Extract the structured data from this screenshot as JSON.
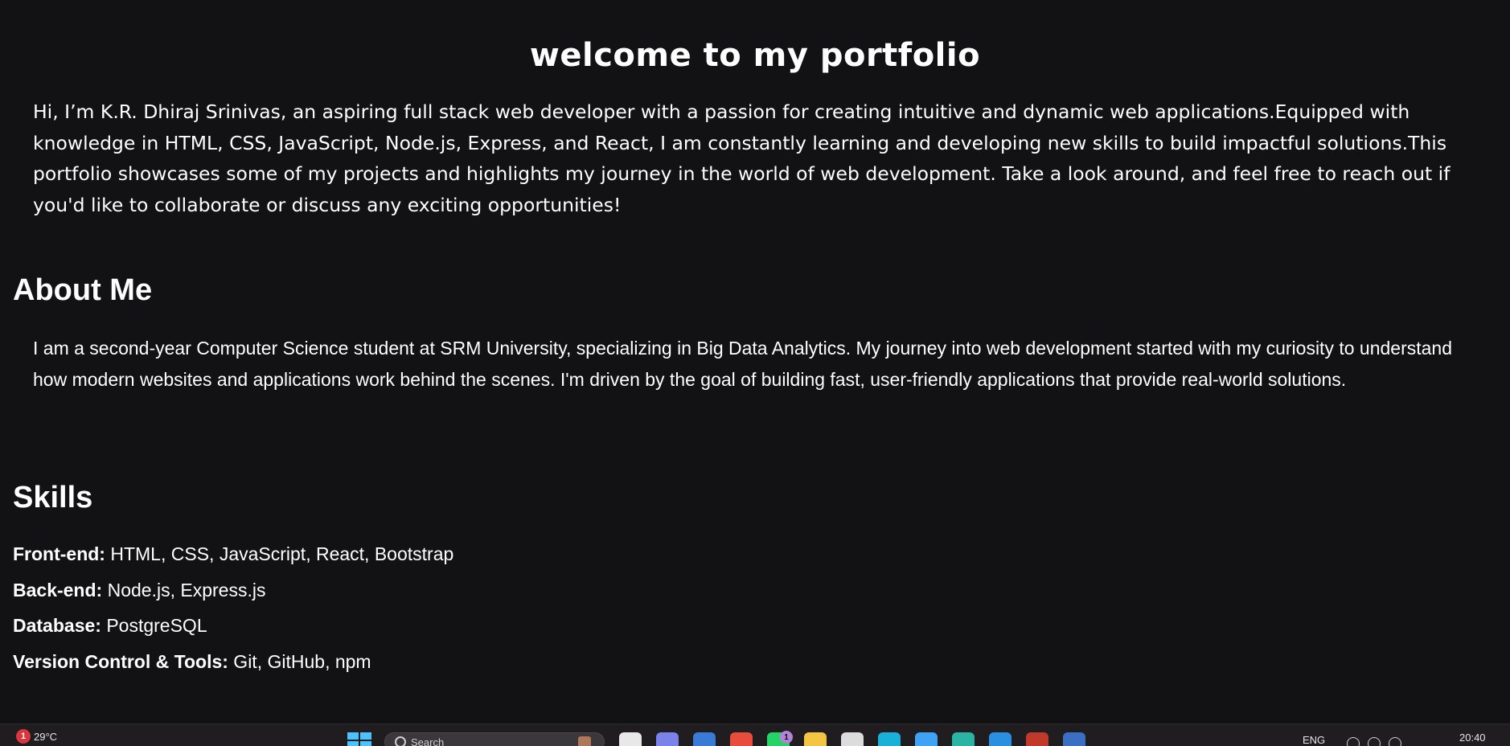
{
  "hero": {
    "title": "welcome to my portfolio",
    "intro": "Hi, I’m K.R. Dhiraj Srinivas, an aspiring full stack web developer with a passion for creating intuitive and dynamic web applications.Equipped with knowledge in HTML, CSS, JavaScript, Node.js, Express, and React, I am constantly learning and developing new skills to build impactful solutions.This portfolio showcases some of my projects and highlights my journey in the world of web development. Take a look around, and feel free to reach out if you'd like to collaborate or discuss any exciting opportunities!"
  },
  "about": {
    "heading": "About Me",
    "text": "I am a second-year Computer Science student at SRM University, specializing in Big Data Analytics. My journey into web development started with my curiosity to understand how modern websites and applications work behind the scenes. I'm driven by the goal of building fast, user-friendly applications that provide real-world solutions."
  },
  "skills": {
    "heading": "Skills",
    "items": [
      {
        "category": "Front-end:",
        "value": " HTML, CSS, JavaScript, React, Bootstrap"
      },
      {
        "category": "Back-end:",
        "value": " Node.js, Express.js"
      },
      {
        "category": "Database:",
        "value": " PostgreSQL"
      },
      {
        "category": "Version Control & Tools:",
        "value": " Git, GitHub, npm"
      }
    ]
  },
  "taskbar": {
    "weather_badge": "1",
    "temperature": "29°C",
    "search_placeholder": "Search",
    "apps": [
      {
        "icon": "file-explorer-icon",
        "color": "#e8e8e8"
      },
      {
        "icon": "teams-icon",
        "color": "#7b83eb"
      },
      {
        "icon": "copilot-icon",
        "color": "#3a7bd5"
      },
      {
        "icon": "chrome-icon",
        "color": "#e74c3c"
      },
      {
        "icon": "whatsapp-icon",
        "color": "#25d366",
        "badge": "1"
      },
      {
        "icon": "folder-icon",
        "color": "#f4c542"
      },
      {
        "icon": "store-icon",
        "color": "#dcdcdc"
      },
      {
        "icon": "cortana-icon",
        "color": "#1ab1d9"
      },
      {
        "icon": "weather-app-icon",
        "color": "#3fa3f5"
      },
      {
        "icon": "edge-icon",
        "color": "#2bb3a3"
      },
      {
        "icon": "vscode-icon",
        "color": "#2a8fe0"
      },
      {
        "icon": "dev-profile-icon",
        "color": "#c0392b"
      },
      {
        "icon": "notes-icon",
        "color": "#3a6fc4"
      }
    ],
    "language": "ENG",
    "clock": "20:40"
  }
}
